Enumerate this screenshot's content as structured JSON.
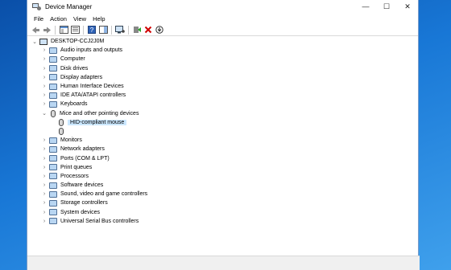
{
  "window": {
    "title": "Device Manager",
    "minimize_glyph": "—",
    "maximize_glyph": "☐",
    "close_glyph": "✕"
  },
  "menu": {
    "file": "File",
    "action": "Action",
    "view": "View",
    "help": "Help"
  },
  "toolbar": {
    "icons": [
      "back-icon",
      "forward-icon",
      "properties-pane-icon",
      "show-hide-console-tree-icon",
      "help-icon",
      "action-pane-icon",
      "scan-hardware-icon",
      "update-driver-icon",
      "uninstall-icon",
      "disable-device-icon"
    ]
  },
  "tree": {
    "root": "DESKTOP-CCJ2J0M",
    "categories": [
      "Audio inputs and outputs",
      "Computer",
      "Disk drives",
      "Display adapters",
      "Human Interface Devices",
      "IDE ATA/ATAPI controllers",
      "Keyboards",
      "Mice and other pointing devices",
      "Monitors",
      "Network adapters",
      "Ports (COM & LPT)",
      "Print queues",
      "Processors",
      "Software devices",
      "Sound, video and game controllers",
      "Storage controllers",
      "System devices",
      "Universal Serial Bus controllers"
    ],
    "expanded_category": "Mice and other pointing devices",
    "mice_children": [
      "HID-compliant mouse",
      ""
    ],
    "selected": "HID-compliant mouse"
  },
  "glyphs": {
    "collapsed": "›",
    "expanded": "⌄"
  },
  "colors": {
    "selection": "#cce8ff",
    "desktop": "#1877d6",
    "uninstall_red": "#d00000"
  }
}
